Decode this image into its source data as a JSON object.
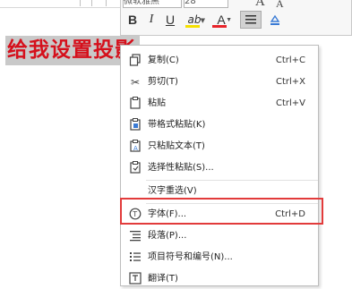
{
  "document": {
    "heading_text": "给我设置投影"
  },
  "mini_toolbar": {
    "font_name": "微软雅黑",
    "font_size": "28",
    "grow_font_label": "A",
    "shrink_font_label": "A",
    "bold_label": "B",
    "italic_label": "I",
    "underline_label": "U",
    "highlight_label": "ab",
    "font_color_label": "A",
    "colors": {
      "highlight": "#f5e000",
      "font_color": "#e8242a",
      "shading": "#3a7bd5"
    }
  },
  "context_menu": {
    "items": [
      {
        "label": "复制(C)",
        "shortcut": "Ctrl+C",
        "icon": "copy-icon"
      },
      {
        "label": "剪切(T)",
        "shortcut": "Ctrl+X",
        "icon": "scissors-icon"
      },
      {
        "label": "粘贴",
        "shortcut": "Ctrl+V",
        "icon": "paste-icon"
      },
      {
        "label": "带格式粘贴(K)",
        "shortcut": "",
        "icon": "paste-formatted-icon"
      },
      {
        "label": "只粘贴文本(T)",
        "shortcut": "",
        "icon": "paste-text-icon"
      },
      {
        "label": "选择性粘贴(S)...",
        "shortcut": "",
        "icon": "paste-special-icon"
      },
      {
        "label": "汉字重选(V)",
        "shortcut": "",
        "icon": ""
      },
      {
        "label": "字体(F)...",
        "shortcut": "Ctrl+D",
        "icon": "font-icon"
      },
      {
        "label": "段落(P)...",
        "shortcut": "",
        "icon": "paragraph-icon"
      },
      {
        "label": "项目符号和编号(N)...",
        "shortcut": "",
        "icon": "bullets-icon"
      },
      {
        "label": "翻译(T)",
        "shortcut": "",
        "icon": "translate-icon"
      }
    ]
  }
}
